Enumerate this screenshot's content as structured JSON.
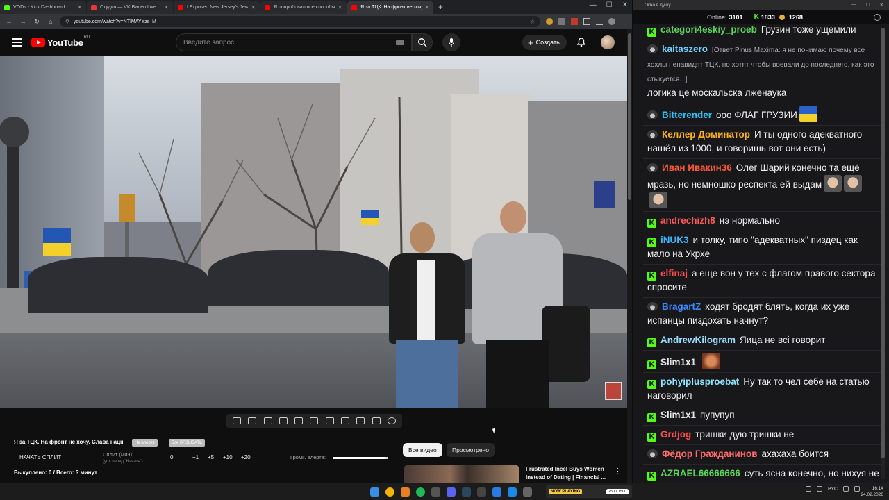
{
  "browser": {
    "tabs": [
      {
        "title": "VODs - Kick Dashboard",
        "color": "#53fc18",
        "active": false
      },
      {
        "title": "Студия — VK Видео Live",
        "color": "#e53935",
        "active": false
      },
      {
        "title": "I Exposed New Jersey's Jewish",
        "color": "#ff0000",
        "active": false
      },
      {
        "title": "Я попробовал все способы бу",
        "color": "#ff0000",
        "active": false
      },
      {
        "title": "Я за ТЦК. На фронт не хочу",
        "color": "#ff0000",
        "active": true
      }
    ],
    "new_tab": "+",
    "address": "youtube.com/watch?v=NTIMAYYzs_M"
  },
  "youtube": {
    "logo_text": "YouTube",
    "logo_region": "RU",
    "search_placeholder": "Введите запрос",
    "create_label": "Создать"
  },
  "player_tools": {
    "title": "Я за ТЦК. На фронт не хочу. Слава нації",
    "chip1": "На алерте",
    "chip2": "Все ВЯЗЫВАТЬ",
    "start_split": "НАЧАТЬ СПЛИТ",
    "split_label": "Сплит (мин):",
    "split_hint": "(уст. перед \"Начать\")",
    "split_values": [
      "0",
      "+1",
      "+5",
      "+10",
      "+20"
    ],
    "alert_volume": "Громк. алерта:",
    "alert_volume_level": 0.95,
    "bought": "Выкуплено: 0 / Всего: ? минут"
  },
  "filters": {
    "all": "Все видео",
    "watched": "Просмотрено"
  },
  "recommended": {
    "title": "Frustrated Incel Buys Women Instead of Dating | Financial ..."
  },
  "chat": {
    "window_title": "Окно в душу",
    "online_label": "Online:",
    "online_count": "3101",
    "kick_count": "1833",
    "coin_count": "1268",
    "messages": [
      {
        "platform": "kick",
        "user": "categori4eskiy_proeb",
        "color": "#5bd35b",
        "text": "Грузин тоже ущемили"
      },
      {
        "platform": "twitch",
        "user": "kaitaszero",
        "color": "#6fd3ff",
        "reply": "[Ответ Pinus Maxima: я не понимаю почему все хохлы ненавидят ТЦК, но хотят чтобы воевали до последнего, как это стыкуется...]",
        "text": "логика це москальска лженаука"
      },
      {
        "platform": "twitch",
        "user": "Bitterender",
        "color": "#2ec4f5",
        "text": "ооо ФЛАГ ГРУЗИИ",
        "emote": "flag-ua"
      },
      {
        "platform": "twitch",
        "user": "Келлер Доминатор",
        "color": "#ffb31a",
        "text": "И ты одного адекватного нашёл из 1000, и говоришь вот они есть)"
      },
      {
        "platform": "twitch",
        "user": "Иван Ивакин36",
        "color": "#ff5a36",
        "text": "Олег Шарий конечно та ещё мразь, но немношко респекта ей выдам",
        "emote": "faces"
      },
      {
        "platform": "kick",
        "user": "andrechizh8",
        "color": "#ff5a5a",
        "text": "нэ нормально"
      },
      {
        "platform": "kick",
        "user": "iNUK3",
        "color": "#3ab7ff",
        "text": "и толку, типо \"адекватных\" пиздец как мало на Укрхе"
      },
      {
        "platform": "kick",
        "user": "elfinaj",
        "color": "#ff4d4d",
        "text": "а еще вон у тех с флагом правого сектора спросите"
      },
      {
        "platform": "twitch",
        "user": "BragartZ",
        "color": "#3a8bff",
        "text": "ходят бродят блять, когда их уже испанцы пиздохать начнут?"
      },
      {
        "platform": "kick",
        "user": "AndrewKilogram",
        "color": "#9adfff",
        "text": "Яица не всі говорит"
      },
      {
        "platform": "kick",
        "user": "Slim1x1",
        "color": "#e6e6e6",
        "text": "",
        "emote": "face"
      },
      {
        "platform": "kick",
        "user": "pohyiplusproebat",
        "color": "#8fe3ff",
        "text": "Ну так то чел себе на статью наговорил"
      },
      {
        "platform": "kick",
        "user": "Slim1x1",
        "color": "#e6e6e6",
        "text": "пупупуп"
      },
      {
        "platform": "kick",
        "user": "Grdjog",
        "color": "#ff4d4d",
        "text": "тришки дую тришки не"
      },
      {
        "platform": "twitch",
        "user": "Фёдор Гражданинов",
        "color": "#ff6b6b",
        "text": "ахахаха боится"
      },
      {
        "platform": "kick",
        "user": "AZRAEL66666666",
        "color": "#5bd35b",
        "text": "суть ясна конечно, но нихуя не бачу, что они там пиздят"
      }
    ]
  },
  "taskbar": {
    "now_playing_badge": "NOW PLAYING",
    "now_playing_count": "250 / 1500",
    "lang": "РУС",
    "time": "16:14",
    "date": "24.02.2026"
  }
}
